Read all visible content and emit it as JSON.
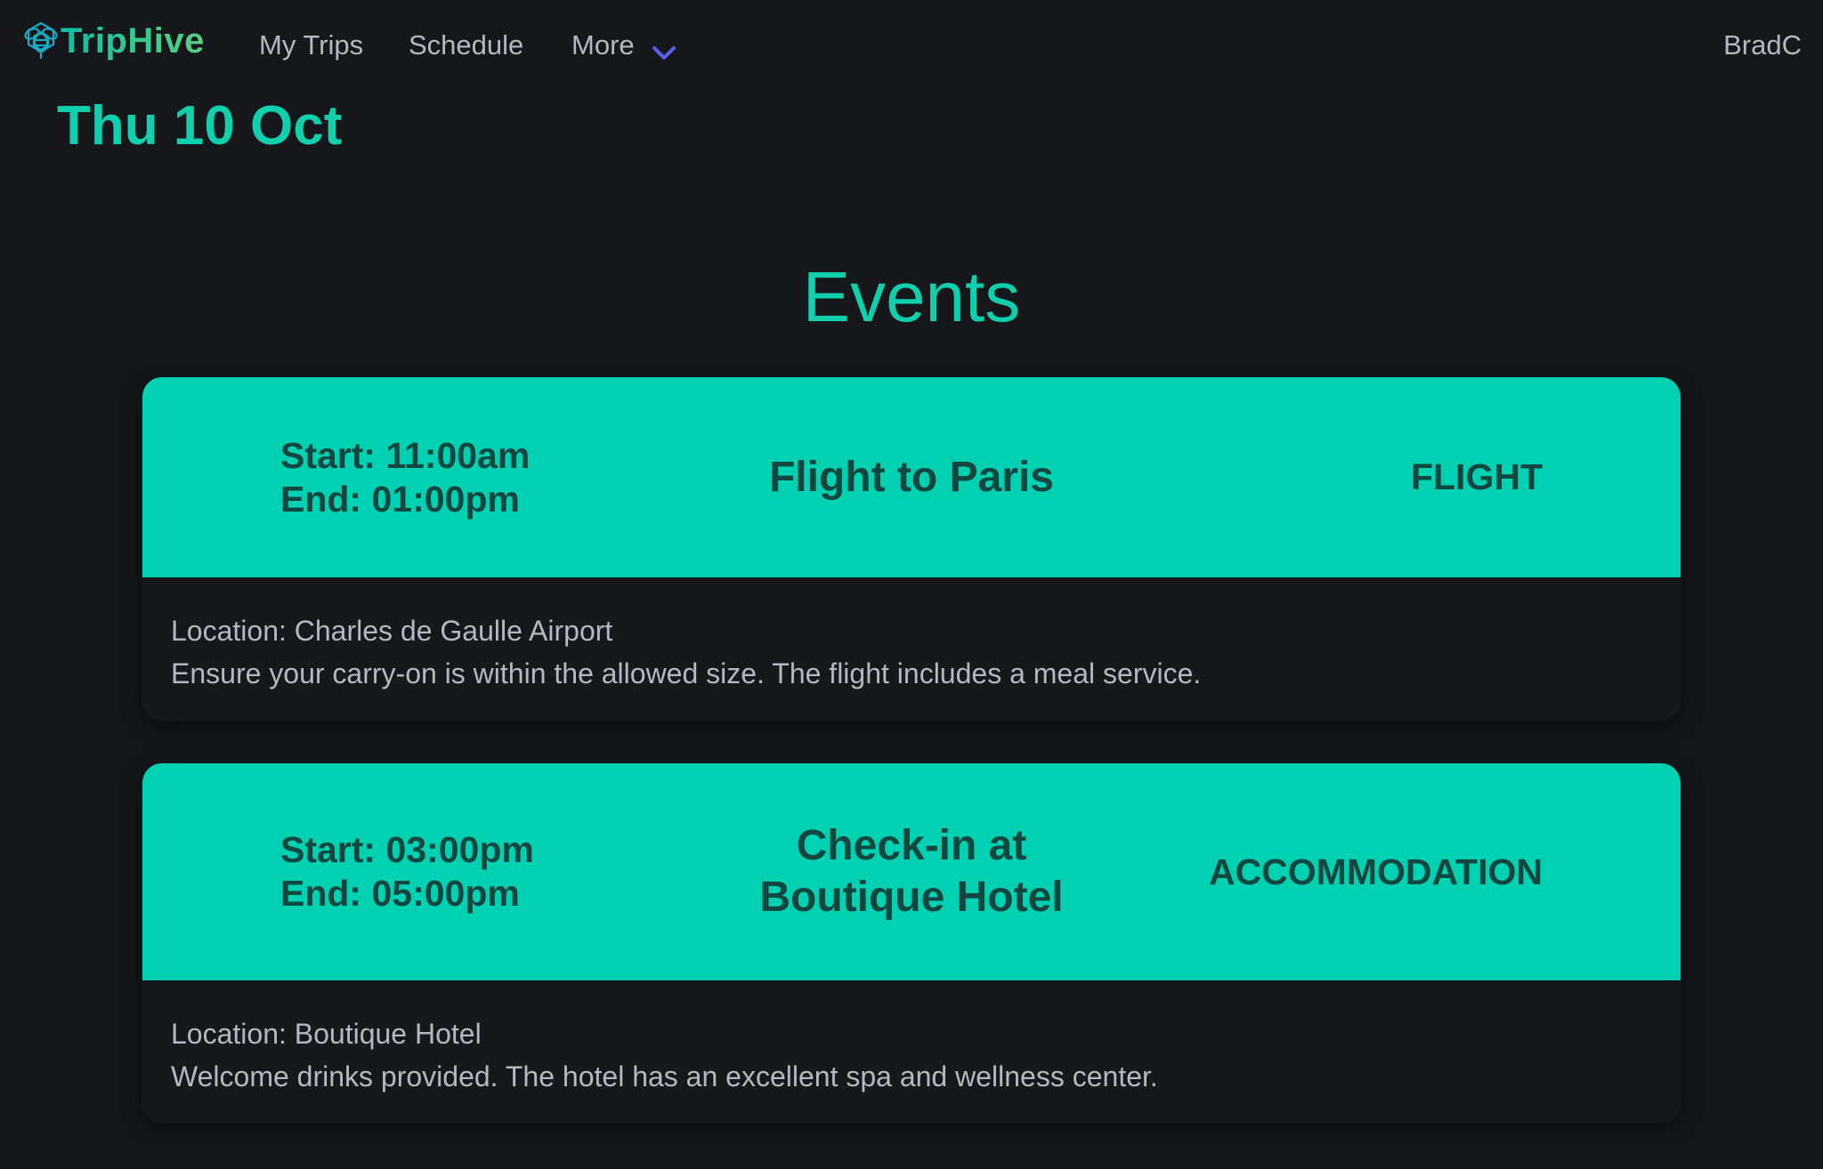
{
  "nav": {
    "brand": "TripHive",
    "links": [
      "My Trips",
      "Schedule"
    ],
    "more_label": "More",
    "user": "BradC"
  },
  "page": {
    "date": "Thu 10 Oct",
    "section_title": "Events"
  },
  "colors": {
    "accent": "#00d1b2",
    "background": "#16171b",
    "card_text": "#12473f",
    "chevron": "#5a5ff0"
  },
  "events": [
    {
      "start": "Start: 11:00am",
      "end": "End: 01:00pm",
      "title_lines": [
        "Flight to Paris"
      ],
      "type": "FLIGHT",
      "location": "Location: Charles de Gaulle Airport",
      "notes": "Ensure your carry-on is within the allowed size. The flight includes a meal service."
    },
    {
      "start": "Start: 03:00pm",
      "end": "End: 05:00pm",
      "title_lines": [
        "Check-in at",
        "Boutique Hotel"
      ],
      "type": "ACCOMMODATION",
      "location": "Location: Boutique Hotel",
      "notes": "Welcome drinks provided. The hotel has an excellent spa and wellness center."
    }
  ],
  "icons": {
    "logo": "bee-logo-icon",
    "more": "chevron-down-icon"
  }
}
